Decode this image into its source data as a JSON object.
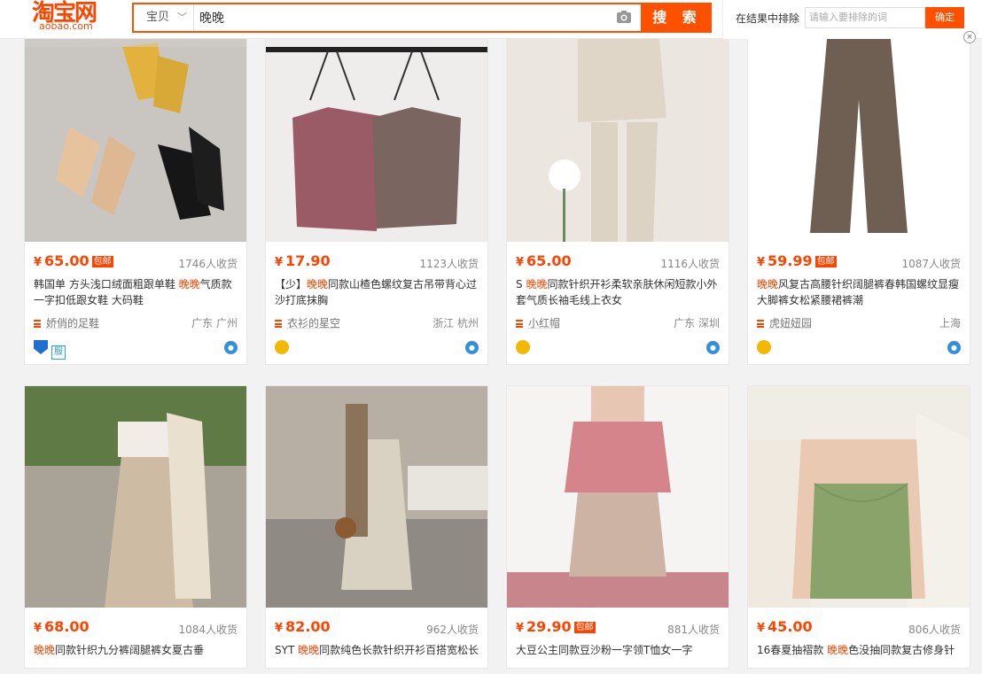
{
  "logo": {
    "text": "淘宝网",
    "sub": "aobao.com"
  },
  "search": {
    "type_label": "宝贝",
    "query": "晚晚",
    "button": "搜 索"
  },
  "exclude": {
    "label": "在结果中排除",
    "placeholder": "请输入要排除的词",
    "button": "确定",
    "close": "×"
  },
  "colors": {
    "accent": "#ff5000",
    "price": "#ff4400"
  },
  "products": [
    {
      "price": "65.00",
      "baoyou": "包邮",
      "sales": "1746人收货",
      "title_pre": "韩国单 方头浅口绒面粗跟单鞋 ",
      "title_hl": "晚晚",
      "title_post": "气质款一字扣低跟女鞋 大码鞋",
      "shop": "娇俏的足鞋",
      "location": "广东 广州"
    },
    {
      "price": "17.90",
      "baoyou": "",
      "sales": "1123人收货",
      "title_pre": "【少】",
      "title_hl": "晚晚",
      "title_post": "同款山楂色螺纹复古吊带背心过沙打底抹胸",
      "shop": "衣衫的星空",
      "location": "浙江 杭州"
    },
    {
      "price": "65.00",
      "baoyou": "",
      "sales": "1116人收货",
      "title_pre": "S ",
      "title_hl": "晚晚",
      "title_post": "同款针织开衫柔软亲肤休闲短款小外套气质长袖毛线上衣女",
      "shop": "小红帽",
      "location": "广东 深圳"
    },
    {
      "price": "59.99",
      "baoyou": "包邮",
      "sales": "1087人收货",
      "title_pre": "",
      "title_hl": "晚晚",
      "title_post": "风复古高腰针织阔腿裤春韩国螺纹显瘦大脚裤女松紧腰裙裤潮",
      "shop": "虎妞妞园",
      "location": "上海"
    },
    {
      "price": "68.00",
      "baoyou": "",
      "sales": "1084人收货",
      "title_pre": "",
      "title_hl": "晚晚",
      "title_post": "同款针织九分裤阔腿裤女夏古垂",
      "shop": "",
      "location": ""
    },
    {
      "price": "82.00",
      "baoyou": "",
      "sales": "962人收货",
      "title_pre": "SYT ",
      "title_hl": "晚晚",
      "title_post": "同款纯色长款针织开衫百搭宽松长",
      "shop": "",
      "location": ""
    },
    {
      "price": "29.90",
      "baoyou": "包邮",
      "sales": "881人收货",
      "title_pre": "",
      "title_hl": "",
      "title_post": "大豆公主同款豆沙粉一字领T恤女一字",
      "shop": "",
      "location": ""
    },
    {
      "price": "45.00",
      "baoyou": "",
      "sales": "806人收货",
      "title_pre": "16春夏抽褶款 ",
      "title_hl": "晚晚",
      "title_post": "色没抽同款复古修身针",
      "shop": "",
      "location": ""
    }
  ]
}
